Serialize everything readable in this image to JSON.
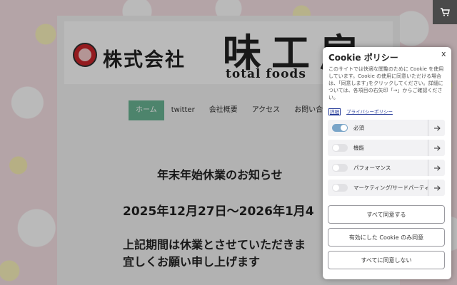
{
  "header": {
    "logo_text": "味工房",
    "company_name": "株式会社",
    "brand_name": "味工房",
    "brand_sub": "total foods"
  },
  "nav": {
    "items": [
      {
        "label": "ホーム",
        "active": true
      },
      {
        "label": "twitter",
        "active": false
      },
      {
        "label": "会社概要",
        "active": false
      },
      {
        "label": "アクセス",
        "active": false
      },
      {
        "label": "お問い合わせ",
        "active": false
      }
    ]
  },
  "notice": {
    "title": "年末年始休業のお知らせ",
    "dates": "2025年12月27日～2026年1月4",
    "line1": "上記期間は休業とさせていただきま",
    "line2": "宜しくお願い申し上げます"
  },
  "cart": {
    "icon": "cart-icon"
  },
  "cookie": {
    "title": "Cookie ポリシー",
    "close_label": "x",
    "description": "このサイトでは快適な閲覧のために Cookie を使用しています。Cookie の使用に同意いただける場合は、｢同意します｣をクリックしてください。詳細については、各項目の右矢印「→」からご確認ください。",
    "details_link": "詳細",
    "privacy_link": "プライバシーポリシー",
    "categories": [
      {
        "label": "必須",
        "enabled": true
      },
      {
        "label": "機能",
        "enabled": false
      },
      {
        "label": "パフォーマンス",
        "enabled": false
      },
      {
        "label": "マーケティング/サードパーティ",
        "enabled": false
      }
    ],
    "buttons": {
      "accept_all": "すべて同意する",
      "accept_selected": "有効にした Cookie のみ同意",
      "reject_all": "すべてに同意しない"
    },
    "colors": {
      "toggle_on": "#7aa5c8",
      "nav_active": "#5fb08c"
    }
  }
}
